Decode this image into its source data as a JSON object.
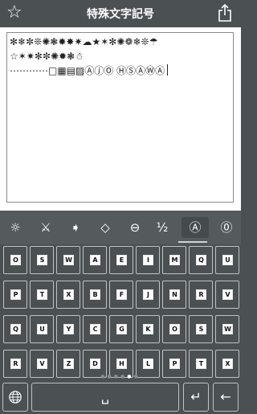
{
  "nav": {
    "title": "特殊文字記号",
    "favorite_icon": "☆",
    "share_icon": "share-icon"
  },
  "editor": {
    "content": "✻❄✼❊✺❃✹✸✷☁★✶✻✺❁❄❊☂\n☆✶✷✻✼✺✹❃☃\n⋯⋯⋯⋯□▦▤▨ⒶⓙⓄ ⒽⓈⒶⓌⒶ"
  },
  "symbol_tabs": [
    {
      "label": "☼",
      "name": "tab-sun"
    },
    {
      "label": "⚔",
      "name": "tab-swords"
    },
    {
      "label": "➧",
      "name": "tab-arrow"
    },
    {
      "label": "◇",
      "name": "tab-diamond"
    },
    {
      "label": "⊖",
      "name": "tab-circle-minus"
    },
    {
      "label": "½",
      "name": "tab-fraction"
    },
    {
      "label": "Ⓐ",
      "name": "tab-circled-letters"
    },
    {
      "label": "⓪",
      "name": "tab-circled-number"
    }
  ],
  "active_tab_index": 6,
  "key_rows": [
    [
      "O",
      "S",
      "W",
      "A",
      "E",
      "I",
      "M",
      "Q",
      "U"
    ],
    [
      "P",
      "T",
      "X",
      "B",
      "F",
      "J",
      "N",
      "R",
      "V"
    ],
    [
      "Q",
      "U",
      "Y",
      "C",
      "G",
      "K",
      "O",
      "S",
      "W"
    ],
    [
      "R",
      "V",
      "Z",
      "D",
      "H",
      "L",
      "P",
      "T",
      "X"
    ]
  ],
  "page_dots": {
    "count": 6,
    "active": 4
  },
  "bottom_keys": {
    "globe_icon": "globe-icon",
    "space_label": "␣",
    "return_label": "↵",
    "backspace_label": "←"
  }
}
